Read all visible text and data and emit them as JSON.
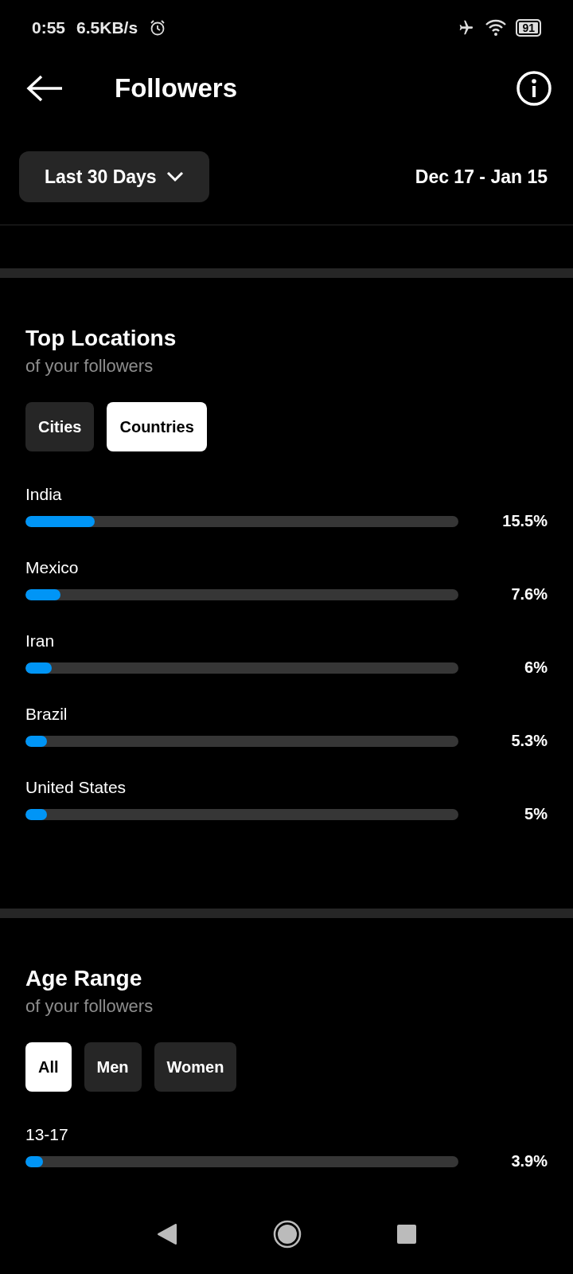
{
  "status_bar": {
    "time": "0:55",
    "speed": "6.5KB/s",
    "battery": "91"
  },
  "header": {
    "title": "Followers"
  },
  "filter": {
    "period": "Last 30 Days",
    "range": "Dec 17 - Jan 15"
  },
  "sections": [
    {
      "title": "Top Locations",
      "subtitle": "of your followers",
      "tabs": [
        {
          "label": "Cities",
          "selected": false
        },
        {
          "label": "Countries",
          "selected": true
        }
      ],
      "rows": [
        {
          "label": "India",
          "level": 0.16,
          "value": "15.5%"
        },
        {
          "label": "Mexico",
          "level": 0.08,
          "value": "7.6%"
        },
        {
          "label": "Iran",
          "level": 0.06,
          "value": "6%"
        },
        {
          "label": "Brazil",
          "level": 0.05,
          "value": "5.3%"
        },
        {
          "label": "United States",
          "level": 0.05,
          "value": "5%"
        }
      ]
    },
    {
      "title": "Age Range",
      "subtitle": "of your followers",
      "tabs": [
        {
          "label": "All",
          "selected": true
        },
        {
          "label": "Men",
          "selected": false
        },
        {
          "label": "Women",
          "selected": false
        }
      ],
      "rows": [
        {
          "label": "13-17",
          "level": 0.04,
          "value": "3.9%"
        }
      ]
    }
  ]
}
